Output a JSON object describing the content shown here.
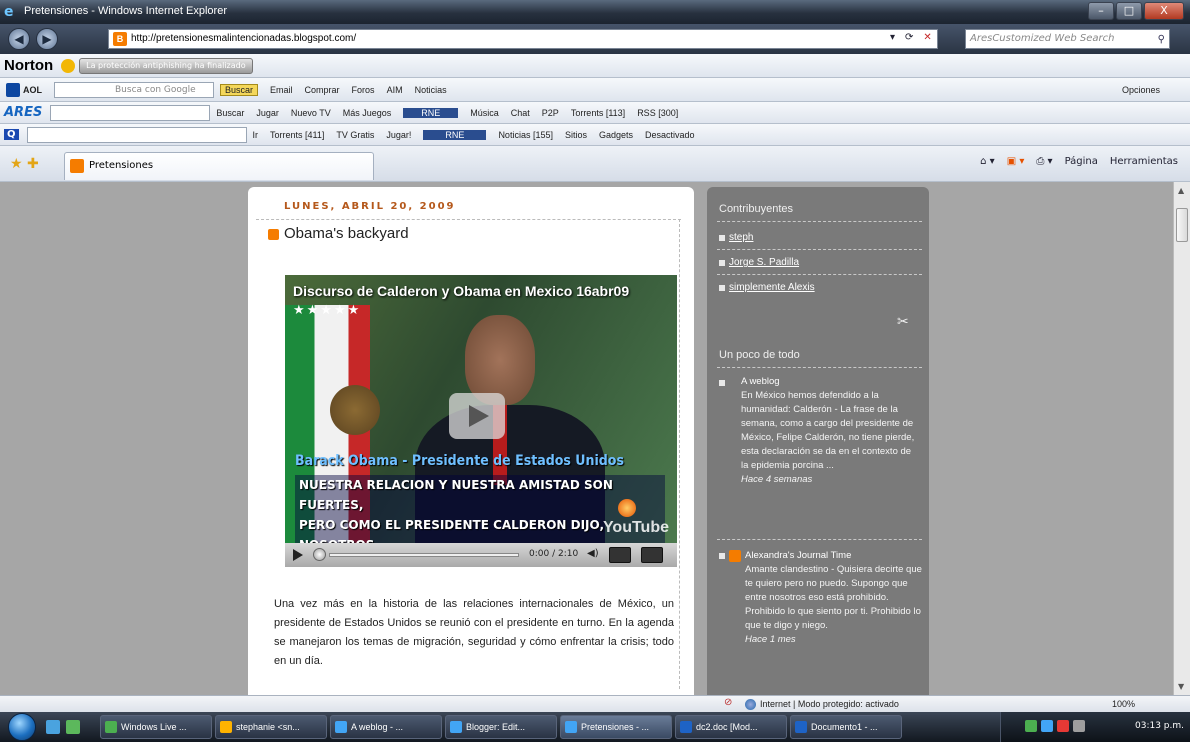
{
  "window": {
    "title": "Pretensiones - Windows Internet Explorer",
    "minimize": "–",
    "maximize": "□",
    "close": "X"
  },
  "address": {
    "url": "http://pretensionesmalintencionadas.blogspot.com/",
    "search_placeholder": "AresCustomized Web Search"
  },
  "toolbars": {
    "norton": {
      "logo": "Norton",
      "status": "La protección antiphishing ha finalizado"
    },
    "aol": {
      "logo": "AOL",
      "search_label": "Busca con Google",
      "items": [
        "Buscar",
        "Email",
        "Comprar",
        "Foros",
        "AIM",
        "Noticias"
      ],
      "right": "Opciones"
    },
    "ares": {
      "logo": "ARES",
      "items": [
        "Buscar",
        "Jugar",
        "Nuevo TV",
        "Más Juegos",
        "Música",
        "Chat",
        "P2P",
        "Torrents [113]",
        "RSS [300]"
      ]
    },
    "qbar": {
      "items": [
        "Ir",
        "Torrents [411]",
        "TV Gratis",
        "Jugar!",
        "Noticias [155]",
        "Sitios",
        "Gadgets",
        "Desactivado"
      ]
    },
    "tab_label": "Pretensiones",
    "cmd": [
      "Página",
      "Herramientas"
    ]
  },
  "post": {
    "date": "LUNES, ABRIL 20, 2009",
    "title": "Obama's backyard",
    "video": {
      "title": "Discurso de Calderon y Obama en Mexico 16abr09",
      "stars": "★★★★★",
      "caption_name": "Barack Obama - Presidente de Estados Unidos",
      "caption_line1": "NUESTRA RELACION Y NUESTRA AMISTAD SON FUERTES,",
      "caption_line2": "PERO COMO EL PRESIDENTE CALDERON DIJO, NOSOTROS",
      "brand": "YouTube",
      "time": "0:00 / 2:10"
    },
    "body": "Una vez más en la historia de las relaciones internacionales de México, un presidente de Estados Unidos se reunió con el presidente en turno. En la agenda se manejaron los temas de migración, seguridad y cómo enfrentar la crisis; todo en un día."
  },
  "sidebar": {
    "contrib_title": "Contribuyentes",
    "contributors": [
      "steph",
      "Jorge S. Padilla",
      "simplemente Alexis"
    ],
    "section_title": "Un poco de todo",
    "entry1": {
      "head": "A weblog",
      "text": "En México hemos defendido a la humanidad: Calderón - La frase de la semana, como a cargo del presidente de México, Felipe Calderón, no tiene pierde, esta declaración se da en el contexto de la epidemia porcina ...",
      "ago": "Hace 4 semanas"
    },
    "entry2": {
      "head": "Alexandra's Journal Time",
      "text": "Amante clandestino - Quisiera decirte que te quiero pero no puedo. Supongo que entre nosotros eso está prohibido. Prohibido lo que siento por ti. Prohibido lo que te digo y niego.",
      "ago": "Hace 1 mes"
    }
  },
  "status": {
    "zone": "Internet | Modo protegido: activado",
    "zoom": "100%"
  },
  "taskbar": {
    "tasks": [
      "Windows Live ...",
      "stephanie <sn...",
      "A weblog - ...",
      "Blogger: Edit...",
      "Pretensiones - ...",
      "dc2.doc [Mod...",
      "Documento1 - ..."
    ],
    "clock": "03:13 p.m."
  }
}
